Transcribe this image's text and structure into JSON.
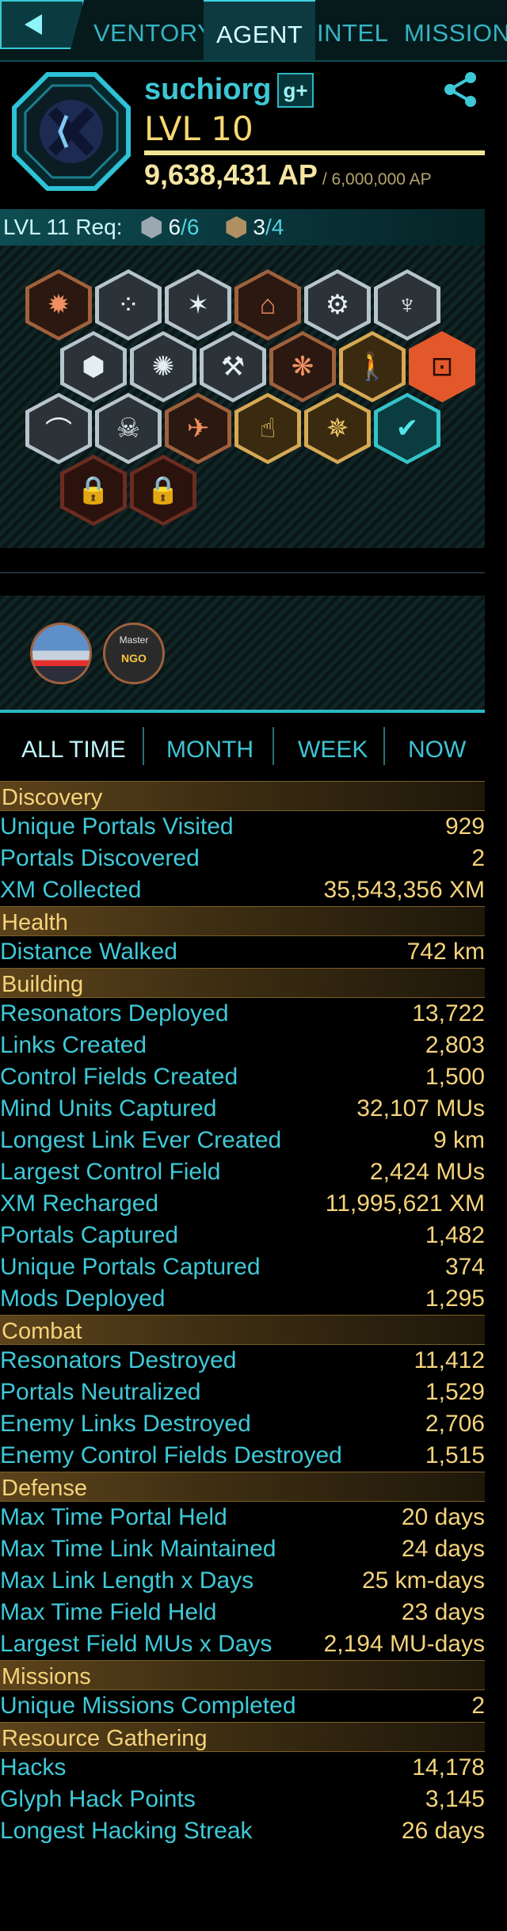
{
  "nav": {
    "tabs": [
      {
        "label": "VENTORY"
      },
      {
        "label": "AGENT"
      },
      {
        "label": "INTEL"
      },
      {
        "label": "MISSIONS"
      }
    ]
  },
  "profile": {
    "username": "suchiorg",
    "gplus_label": "g+",
    "level": "LVL 10",
    "ap": "9,638,431 AP",
    "ap_required": "/ 6,000,000 AP"
  },
  "level_req": {
    "label": "LVL 11 Req:",
    "silver_have": "6",
    "silver_need": "/6",
    "gold_have": "3",
    "gold_need": "/4"
  },
  "event_badges": {
    "master_text": "Master",
    "ngo_text": "NGO"
  },
  "time_tabs": [
    {
      "label": "ALL TIME"
    },
    {
      "label": "MONTH"
    },
    {
      "label": "WEEK"
    },
    {
      "label": "NOW"
    }
  ],
  "sections": [
    {
      "title": "Discovery",
      "rows": [
        {
          "label": "Unique Portals Visited",
          "value": "929"
        },
        {
          "label": "Portals Discovered",
          "value": "2"
        },
        {
          "label": "XM Collected",
          "value": "35,543,356 XM"
        }
      ]
    },
    {
      "title": "Health",
      "rows": [
        {
          "label": "Distance Walked",
          "value": "742 km"
        }
      ]
    },
    {
      "title": "Building",
      "rows": [
        {
          "label": "Resonators Deployed",
          "value": "13,722"
        },
        {
          "label": "Links Created",
          "value": "2,803"
        },
        {
          "label": "Control Fields Created",
          "value": "1,500"
        },
        {
          "label": "Mind Units Captured",
          "value": "32,107 MUs"
        },
        {
          "label": "Longest Link Ever Created",
          "value": "9 km"
        },
        {
          "label": "Largest Control Field",
          "value": "2,424 MUs"
        },
        {
          "label": "XM Recharged",
          "value": "11,995,621 XM"
        },
        {
          "label": "Portals Captured",
          "value": "1,482"
        },
        {
          "label": "Unique Portals Captured",
          "value": "374"
        },
        {
          "label": "Mods Deployed",
          "value": "1,295"
        }
      ]
    },
    {
      "title": "Combat",
      "rows": [
        {
          "label": "Resonators Destroyed",
          "value": "11,412"
        },
        {
          "label": "Portals Neutralized",
          "value": "1,529"
        },
        {
          "label": "Enemy Links Destroyed",
          "value": "2,706"
        },
        {
          "label": "Enemy Control Fields Destroyed",
          "value": "1,515"
        }
      ]
    },
    {
      "title": "Defense",
      "rows": [
        {
          "label": "Max Time Portal Held",
          "value": "20 days"
        },
        {
          "label": "Max Time Link Maintained",
          "value": "24 days"
        },
        {
          "label": "Max Link Length x Days",
          "value": "25 km-days"
        },
        {
          "label": "Max Time Field Held",
          "value": "23 days"
        },
        {
          "label": "Largest Field MUs x Days",
          "value": "2,194 MU-days"
        }
      ]
    },
    {
      "title": "Missions",
      "rows": [
        {
          "label": "Unique Missions Completed",
          "value": "2"
        }
      ]
    },
    {
      "title": "Resource Gathering",
      "rows": [
        {
          "label": "Hacks",
          "value": "14,178"
        },
        {
          "label": "Glyph Hack Points",
          "value": "3,145"
        },
        {
          "label": "Longest Hacking Streak",
          "value": "26 days"
        }
      ]
    }
  ],
  "colors": {
    "accent": "#3fc9d8",
    "value": "#f5d37a",
    "section_bg": "#4a3616"
  }
}
